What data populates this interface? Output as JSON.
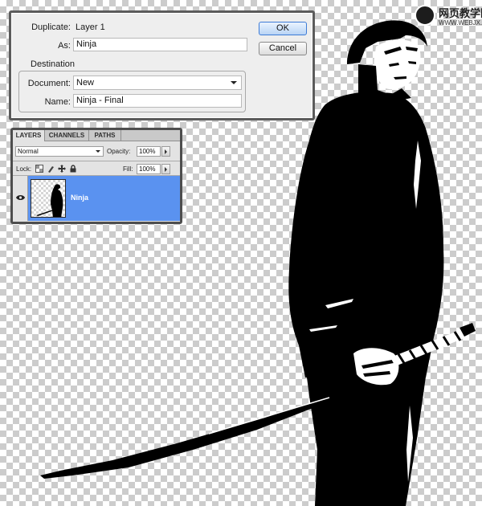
{
  "watermark": {
    "text": "网页教学网",
    "url": "WWW.WEBJX.COM"
  },
  "duplicate_dialog": {
    "duplicate_label": "Duplicate:",
    "duplicate_value": "Layer 1",
    "as_label": "As:",
    "as_value": "Ninja",
    "destination_title": "Destination",
    "document_label": "Document:",
    "document_value": "New",
    "name_label": "Name:",
    "name_value": "Ninja - Final",
    "ok_label": "OK",
    "cancel_label": "Cancel"
  },
  "layers_panel": {
    "tabs": [
      {
        "label": "LAYERS",
        "active": true
      },
      {
        "label": "CHANNELS",
        "active": false
      },
      {
        "label": "PATHS",
        "active": false
      }
    ],
    "blend_mode": "Normal",
    "opacity_label": "Opacity:",
    "opacity_value": "100%",
    "lock_label": "Lock:",
    "fill_label": "Fill:",
    "fill_value": "100%",
    "layer": {
      "name": "Ninja",
      "visible": true,
      "selected": true,
      "highlight_color": "#5a92f0"
    }
  }
}
